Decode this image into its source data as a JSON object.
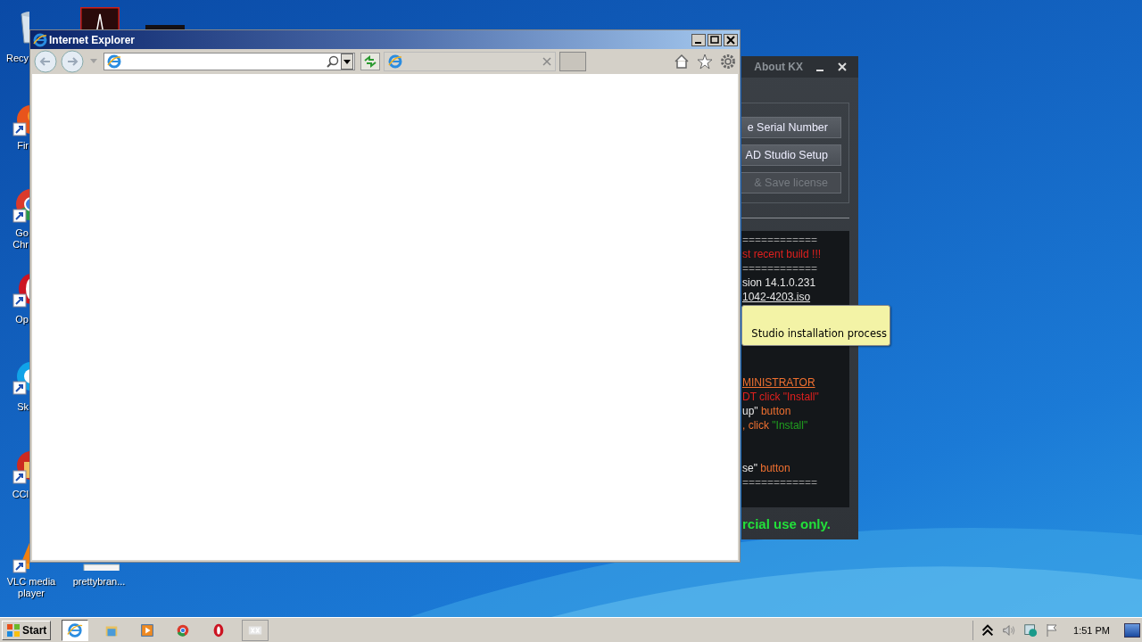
{
  "desktop_icons": [
    {
      "kind": "recycle-bin",
      "label_lines": [
        "Recy"
      ],
      "shortcut": false
    },
    {
      "kind": "firefox",
      "label_lines": [
        "Fir"
      ],
      "shortcut": true
    },
    {
      "kind": "chrome",
      "label_lines": [
        "Go",
        "Chr"
      ],
      "shortcut": true
    },
    {
      "kind": "opera",
      "label_lines": [
        "Op"
      ],
      "shortcut": true
    },
    {
      "kind": "skype",
      "label_lines": [
        "Sk"
      ],
      "shortcut": true
    },
    {
      "kind": "ccleaner",
      "label_lines": [
        "CCl"
      ],
      "shortcut": true
    },
    {
      "kind": "vlc",
      "label_lines": [
        "VLC media",
        "player"
      ],
      "shortcut": true
    },
    {
      "kind": "file",
      "label_lines": [
        "prettybran..."
      ],
      "shortcut": false
    },
    {
      "kind": "acrobat",
      "shortcut": false
    },
    {
      "kind": "dark-file",
      "shortcut": false
    }
  ],
  "kx_window": {
    "title": "About KX",
    "buttons": [
      {
        "label": "e Serial Number",
        "disabled": false
      },
      {
        "label": "AD Studio Setup",
        "disabled": false
      },
      {
        "label": "& Save license",
        "disabled": true
      }
    ],
    "console_blocks": [
      [
        [
          {
            "text": "============",
            "color": "#9a9a9a",
            "underline": false
          }
        ],
        [
          {
            "text": "st recent build !!!",
            "color": "#e0201e",
            "underline": false
          }
        ],
        [
          {
            "text": "============",
            "color": "#9a9a9a",
            "underline": false
          }
        ],
        [
          {
            "text": "sion 14.1.0.231",
            "color": "#e8e8e8",
            "underline": false
          }
        ],
        [
          {
            "text": "1042-4203.iso",
            "color": "#e8e8e8",
            "underline": true
          }
        ]
      ],
      [
        [
          {
            "text": "MINISTRATOR",
            "color": "#f07030",
            "underline": true
          }
        ],
        [
          {
            "text": "DT click \"Install\"",
            "color": "#e0201e",
            "underline": false
          }
        ],
        [
          {
            "text": "up\"",
            "color": "#e8e8e8",
            "underline": false
          },
          {
            "text": " button",
            "color": "#f07030",
            "underline": false
          }
        ],
        [
          {
            "text": ", click ",
            "color": "#f07030",
            "underline": false
          },
          {
            "text": "\"Install\"",
            "color": "#20a020",
            "underline": false
          }
        ]
      ],
      [
        [
          {
            "text": "se\"",
            "color": "#e8e8e8",
            "underline": false
          },
          {
            "text": " button",
            "color": "#f07030",
            "underline": false
          }
        ],
        [
          {
            "text": "============",
            "color": "#9a9a9a",
            "underline": false
          }
        ]
      ]
    ],
    "footer": "rcial use only.",
    "tooltip": "Studio installation process"
  },
  "ie_window": {
    "title": "Internet Explorer"
  },
  "taskbar": {
    "start": "Start",
    "apps": [
      {
        "kind": "ie",
        "selected": true
      },
      {
        "kind": "explorer",
        "selected": false
      },
      {
        "kind": "media-player",
        "selected": false
      },
      {
        "kind": "chrome",
        "selected": false
      },
      {
        "kind": "opera",
        "selected": false
      },
      {
        "kind": "kx",
        "selected": false
      }
    ],
    "clock": "1:51 PM"
  }
}
